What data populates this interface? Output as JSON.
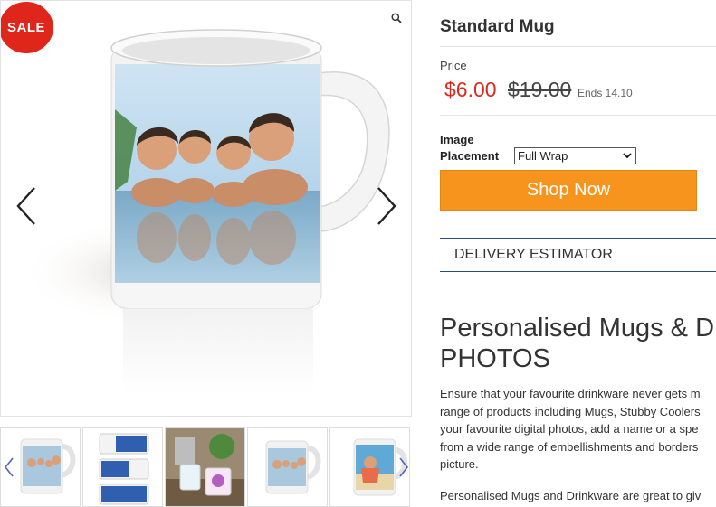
{
  "gallery": {
    "sale_badge": "SALE",
    "main_image": "mug-family-photo",
    "thumbnails": [
      {
        "name": "thumb-mug-family"
      },
      {
        "name": "thumb-mug-placement-options"
      },
      {
        "name": "thumb-mugs-table"
      },
      {
        "name": "thumb-mug-family-alt"
      },
      {
        "name": "thumb-mug-beach"
      }
    ],
    "icons": {
      "zoom": "magnifier-icon",
      "prev": "chevron-left-icon",
      "next": "chevron-right-icon"
    }
  },
  "product": {
    "title": "Standard Mug",
    "price_label": "Price",
    "price_now": "$6.00",
    "price_was": "$19.00",
    "price_ends": "Ends 14.10",
    "placement_label": "Image\nPlacement",
    "placement_value": "Full Wrap",
    "shop_button": "Shop Now",
    "delivery_label": "DELIVERY ESTIMATOR"
  },
  "description": {
    "heading": "Personalised Mugs & D\nPHOTOS",
    "body": "Ensure that your favourite drinkware never gets m\nrange of products including Mugs, Stubby Coolers\nyour favourite digital photos, add a name or a spe\nfrom a wide range of embellishments and borders\npicture.",
    "body2": "Personalised Mugs and Drinkware are great to giv"
  },
  "colors": {
    "sale": "#e0251b",
    "price_now": "#d92b1f",
    "shop_button": "#f7941d",
    "delivery_border": "#2b4d7d"
  }
}
